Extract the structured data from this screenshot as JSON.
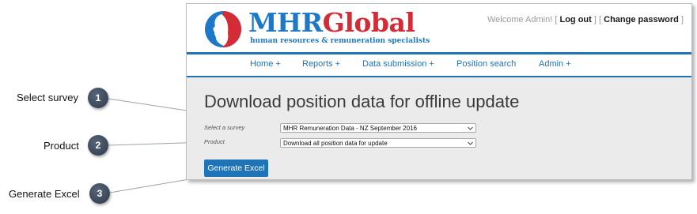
{
  "brand": {
    "name_part1": "MHR",
    "name_part2": "Global",
    "tagline": "human resources & remuneration specialists",
    "colors": {
      "blue": "#1e78c8",
      "red": "#d42c36"
    }
  },
  "user_bar": {
    "welcome": "Welcome Admin!",
    "logout": "Log out",
    "change_password": "Change password",
    "bracket_open": "[",
    "bracket_close": "]"
  },
  "nav": {
    "items": [
      "Home +",
      "Reports +",
      "Data submission +",
      "Position search",
      "Admin +"
    ]
  },
  "page": {
    "title": "Download position data for offline update",
    "survey_label": "Select a survey",
    "survey_value": "MHR Remuneration Data - NZ September 2016",
    "product_label": "Product",
    "product_value": "Download all position data for update",
    "generate_button": "Generate Excel"
  },
  "callouts": [
    {
      "number": "1",
      "label": "Select survey"
    },
    {
      "number": "2",
      "label": "Product"
    },
    {
      "number": "3",
      "label": "Generate Excel"
    }
  ],
  "icons": {
    "logo": "profile-faces-logo-icon",
    "dropdown": "chevron-down-icon"
  }
}
